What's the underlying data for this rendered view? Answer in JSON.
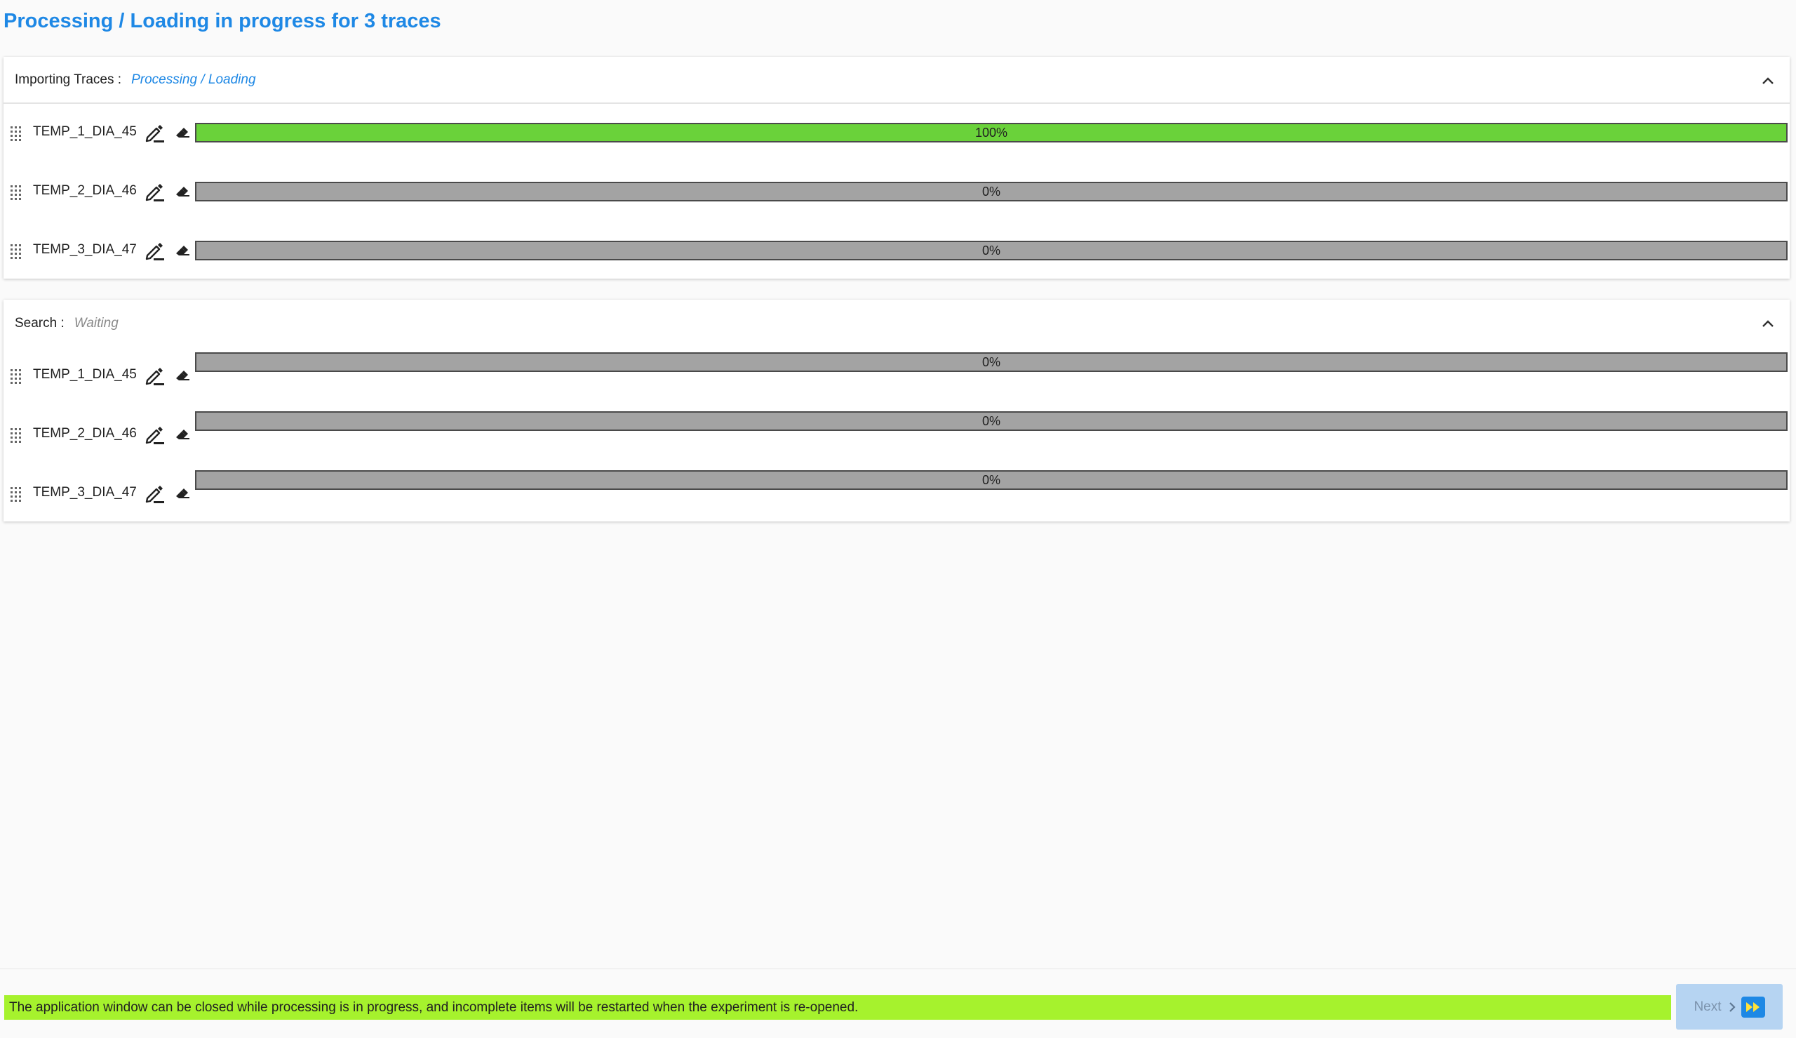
{
  "page": {
    "title": "Processing / Loading in progress for 3 traces"
  },
  "import_panel": {
    "label": "Importing Traces :",
    "status": "Processing / Loading",
    "rows": [
      {
        "name": "TEMP_1_DIA_45",
        "progress": 100,
        "progress_label": "100%"
      },
      {
        "name": "TEMP_2_DIA_46",
        "progress": 0,
        "progress_label": "0%"
      },
      {
        "name": "TEMP_3_DIA_47",
        "progress": 0,
        "progress_label": "0%"
      }
    ]
  },
  "search_panel": {
    "label": "Search :",
    "status": "Waiting",
    "rows": [
      {
        "name": "TEMP_1_DIA_45",
        "progress": 0,
        "progress_label": "0%"
      },
      {
        "name": "TEMP_2_DIA_46",
        "progress": 0,
        "progress_label": "0%"
      },
      {
        "name": "TEMP_3_DIA_47",
        "progress": 0,
        "progress_label": "0%"
      }
    ]
  },
  "footer": {
    "message": "The application window can be closed while processing is in progress, and incomplete items will be restarted when the experiment is re-opened.",
    "next_label": "Next"
  },
  "colors": {
    "accent": "#1e88e5",
    "progress_done": "#6ad23a",
    "progress_track": "#a3a3a3",
    "message_background": "#a6f22d",
    "next_button_background": "#b6d4f2"
  },
  "icons": {
    "drag": "drag-handle-icon",
    "edit": "pencil-icon",
    "erase": "eraser-icon",
    "collapse": "chevron-up-icon",
    "next": "chevron-right-icon",
    "fast_forward": "fast-forward-icon"
  }
}
